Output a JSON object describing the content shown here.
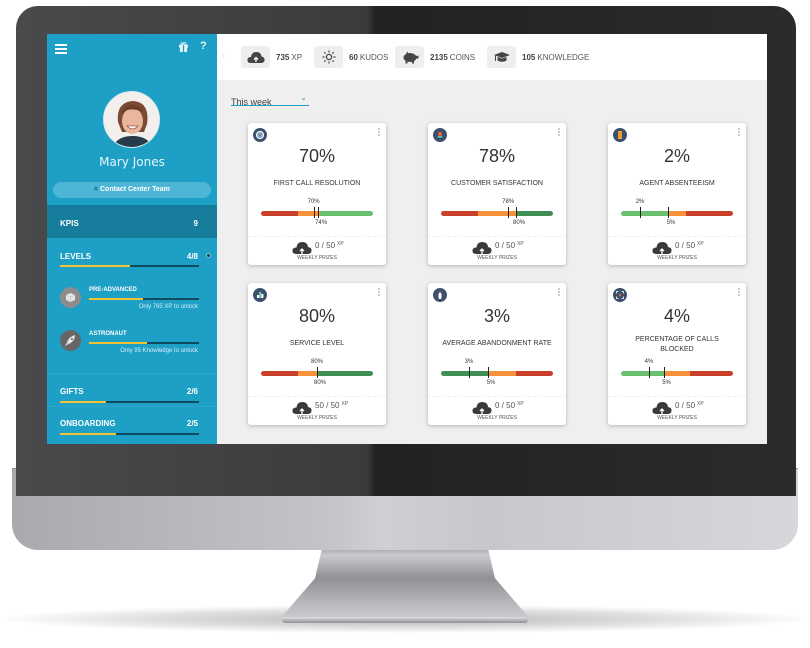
{
  "sidebar": {
    "user_name": "Mary Jones",
    "team": "Contact Center Team",
    "team_prefix": "#",
    "help_label": "?",
    "kpis": {
      "label": "KPIS",
      "count": "9"
    },
    "levels": {
      "label": "LEVELS",
      "count": "4/8",
      "progress": 0.5,
      "items": [
        {
          "name": "PRE-ADVANCED",
          "hint": "Only 765 XP to unlock",
          "progress": 0.49,
          "icon": "cube-icon"
        },
        {
          "name": "ASTRONAUT",
          "hint": "Only 95 Knowledge to unlock",
          "progress": 0.53,
          "icon": "rocket-icon"
        }
      ]
    },
    "gifts": {
      "label": "GIFTS",
      "count": "2/6",
      "progress": 0.33
    },
    "onboarding": {
      "label": "ONBOARDING",
      "count": "2/5",
      "progress": 0.4
    }
  },
  "topbar": {
    "nav_prev": "‹",
    "stats": [
      {
        "icon": "cloud-upload-icon",
        "value": "735",
        "unit": "XP"
      },
      {
        "icon": "sun-icon",
        "value": "60",
        "unit": "KUDOS"
      },
      {
        "icon": "piggy-bank-icon",
        "value": "2135",
        "unit": "COINS"
      },
      {
        "icon": "graduation-cap-icon",
        "value": "105",
        "unit": "KNOWLEDGE"
      }
    ]
  },
  "filter": {
    "period": "This week",
    "chevron": "⌄"
  },
  "colors": {
    "red": "#c8402a",
    "orange": "#f7923a",
    "light_green": "#6abf6f",
    "dark_green": "#3f8f55",
    "sidebar": "#1e9fc6",
    "xp_bar": "#f1c232"
  },
  "kpis": [
    {
      "value": "70%",
      "title": "FIRST CALL RESOLUTION",
      "current": 70,
      "target": 74,
      "current_label": "70%",
      "target_label": "74%",
      "segments": [
        [
          "red",
          0.33
        ],
        [
          "orange",
          0.2
        ],
        [
          "light_green",
          0.47
        ]
      ],
      "current_pos": 0.47,
      "target_pos": 0.51,
      "prize": "0 / 50",
      "prize_unit": "XP",
      "prize_label": "WEEKLY PRIZES"
    },
    {
      "value": "78%",
      "title": "CUSTOMER SATISFACTION",
      "current": 78,
      "target": 80,
      "current_label": "78%",
      "target_label": "80%",
      "segments": [
        [
          "red",
          0.33
        ],
        [
          "orange",
          0.34
        ],
        [
          "dark_green",
          0.33
        ]
      ],
      "current_pos": 0.6,
      "target_pos": 0.67,
      "prize": "0 / 50",
      "prize_unit": "XP",
      "prize_label": "WEEKLY PRIZES"
    },
    {
      "value": "2%",
      "title": "AGENT ABSENTEEISM",
      "current": 2,
      "target": 5,
      "current_label": "2%",
      "target_label": "5%",
      "segments": [
        [
          "light_green",
          0.42
        ],
        [
          "orange",
          0.16
        ],
        [
          "red",
          0.42
        ]
      ],
      "current_pos": 0.17,
      "target_pos": 0.42,
      "prize": "0 / 50",
      "prize_unit": "XP",
      "prize_label": "WEEKLY PRIZES"
    },
    {
      "value": "80%",
      "title": "SERVICE LEVEL",
      "current": 80,
      "target": 80,
      "current_label": "80%",
      "target_label": "80%",
      "segments": [
        [
          "red",
          0.33
        ],
        [
          "orange",
          0.17
        ],
        [
          "dark_green",
          0.5
        ]
      ],
      "current_pos": 0.5,
      "target_pos": 0.5,
      "prize": "50 / 50",
      "prize_unit": "XP",
      "prize_label": "WEEKLY PRIZES"
    },
    {
      "value": "3%",
      "title": "AVERAGE ABANDONMENT RATE",
      "current": 3,
      "target": 5,
      "current_label": "3%",
      "target_label": "5%",
      "segments": [
        [
          "dark_green",
          0.42
        ],
        [
          "orange",
          0.25
        ],
        [
          "red",
          0.33
        ]
      ],
      "current_pos": 0.25,
      "target_pos": 0.42,
      "prize": "0 / 50",
      "prize_unit": "XP",
      "prize_label": "WEEKLY PRIZES"
    },
    {
      "value": "4%",
      "title": "PERCENTAGE OF CALLS BLOCKED",
      "current": 4,
      "target": 5,
      "current_label": "4%",
      "target_label": "5%",
      "segments": [
        [
          "light_green",
          0.38
        ],
        [
          "orange",
          0.24
        ],
        [
          "red",
          0.38
        ]
      ],
      "current_pos": 0.25,
      "target_pos": 0.38,
      "prize": "0 / 50",
      "prize_unit": "XP",
      "prize_label": "WEEKLY PRIZES"
    }
  ]
}
